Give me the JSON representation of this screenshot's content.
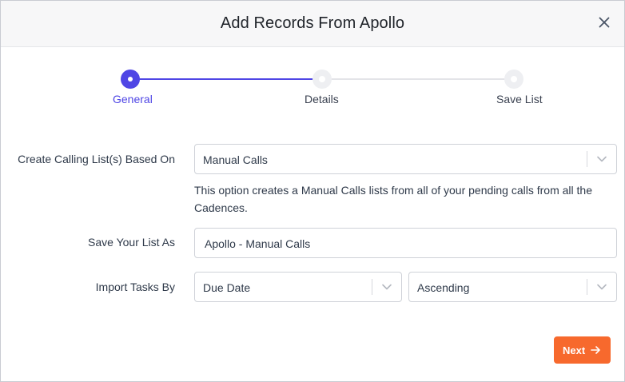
{
  "modal": {
    "title": "Add Records From Apollo"
  },
  "stepper": {
    "steps": [
      {
        "label": "General",
        "state": "active"
      },
      {
        "label": "Details",
        "state": "pending"
      },
      {
        "label": "Save List",
        "state": "pending"
      }
    ],
    "accent_color": "#4f46e5"
  },
  "form": {
    "calling_list": {
      "label": "Create Calling List(s) Based On",
      "selected": "Manual Calls",
      "help": "This option creates a Manual Calls lists from all of your pending calls from all the Cadences."
    },
    "save_list": {
      "label": "Save Your List As",
      "value": "Apollo - Manual Calls"
    },
    "import_tasks": {
      "label": "Import Tasks By",
      "sort_field": "Due Date",
      "sort_order": "Ascending"
    }
  },
  "footer": {
    "next_label": "Next",
    "next_color": "#f7692d"
  },
  "icons": {
    "close": "close-icon",
    "chevron": "chevron-down-icon",
    "next_arrow": "arrow-right-icon"
  }
}
